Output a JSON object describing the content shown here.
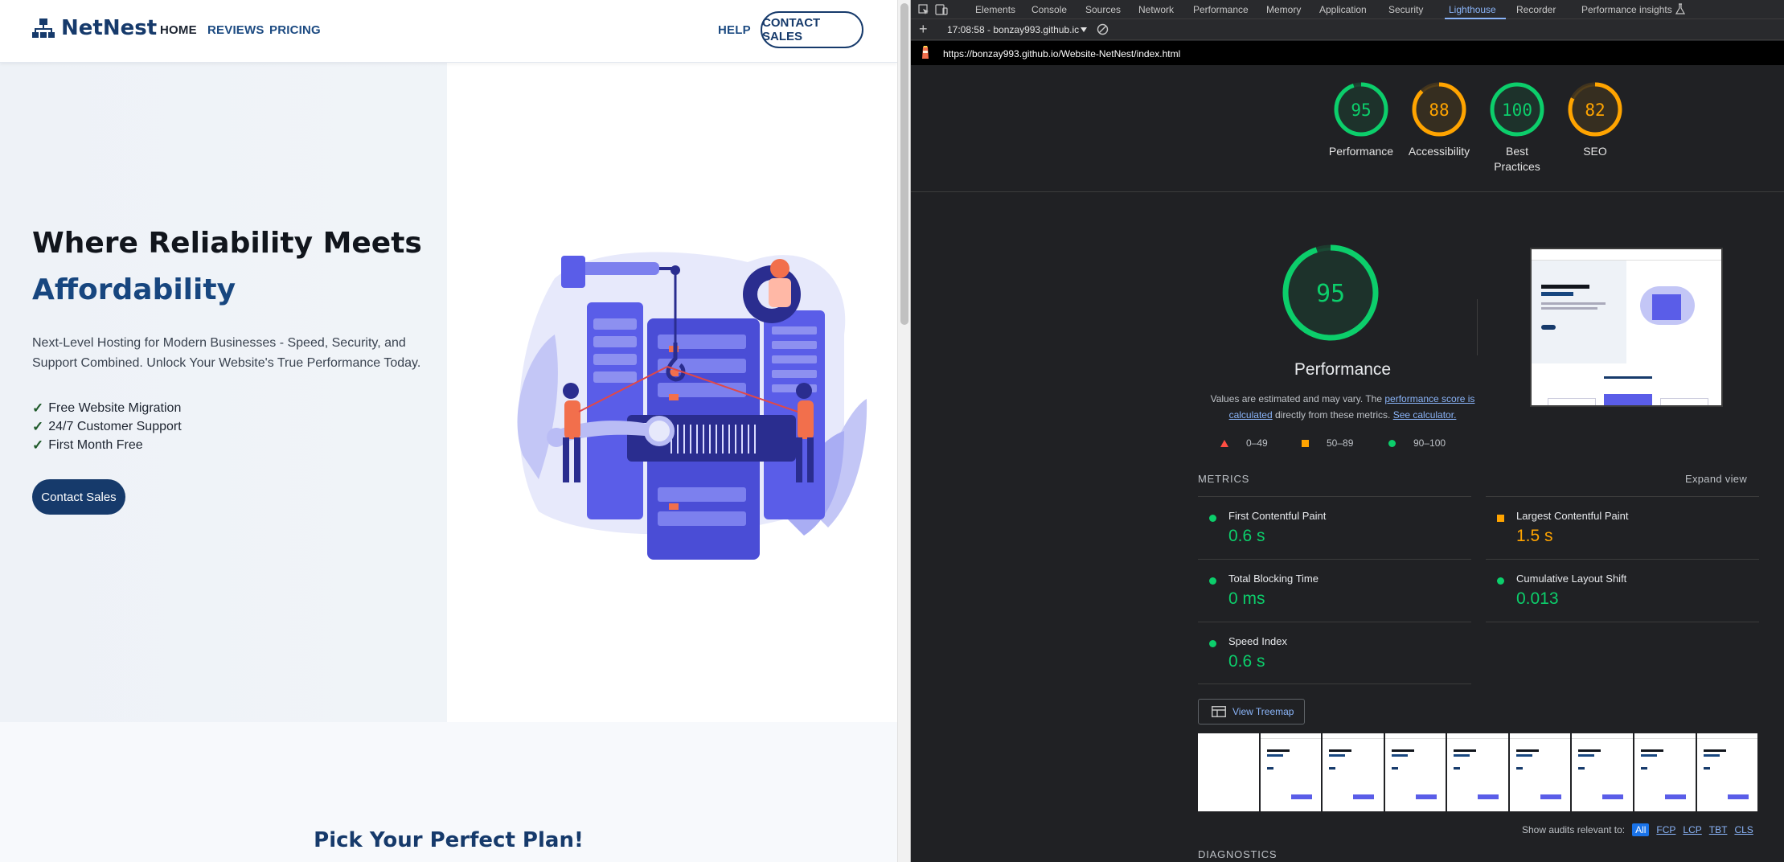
{
  "site": {
    "logo_text": "NetNest",
    "nav": {
      "home": "HOME",
      "reviews": "REVIEWS",
      "pricing": "PRICING",
      "help": "HELP",
      "contact_sales": "CONTACT SALES"
    },
    "hero": {
      "title_line1": "Where Reliability Meets",
      "title_line2": "Affordability",
      "subtitle": "Next-Level Hosting for Modern Businesses - Speed, Security, and Support Combined. Unlock Your Website's True Performance Today.",
      "features": [
        "Free Website Migration",
        "24/7 Customer Support",
        "First Month Free"
      ],
      "check_glyph": "✓",
      "cta": "Contact Sales"
    },
    "plans_title": "Pick Your Perfect Plan!",
    "colors": {
      "brand_navy": "#163a6b",
      "illustration_purple": "#5a5de8",
      "illustration_orange": "#f26f4c"
    }
  },
  "devtools": {
    "tabs": [
      "Elements",
      "Console",
      "Sources",
      "Network",
      "Performance",
      "Memory",
      "Application",
      "Security",
      "Lighthouse",
      "Recorder",
      "Performance insights"
    ],
    "active_tab": "Lighthouse",
    "toolbar_report": "17:08:58 - bonzay993.github.ic",
    "url": "https://bonzay993.github.io/Website-NetNest/index.html",
    "summary_scores": [
      {
        "score": 95,
        "label": "Performance",
        "color": "#0cce6b"
      },
      {
        "score": 88,
        "label": "Accessibility",
        "color": "#ffa400"
      },
      {
        "score": 100,
        "label": "Best Practices",
        "color": "#0cce6b"
      },
      {
        "score": 82,
        "label": "SEO",
        "color": "#ffa400"
      }
    ],
    "performance": {
      "score": 95,
      "title": "Performance",
      "note_prefix": "Values are estimated and may vary. The ",
      "note_link": "performance score is calculated",
      "note_mid": " directly from these metrics. ",
      "note_link2": "See calculator.",
      "legend": [
        "0–49",
        "50–89",
        "90–100"
      ]
    },
    "metrics_heading": "METRICS",
    "expand_view": "Expand view",
    "metrics": [
      {
        "name": "First Contentful Paint",
        "value": "0.6 s",
        "status": "pass"
      },
      {
        "name": "Largest Contentful Paint",
        "value": "1.5 s",
        "status": "average"
      },
      {
        "name": "Total Blocking Time",
        "value": "0 ms",
        "status": "pass"
      },
      {
        "name": "Cumulative Layout Shift",
        "value": "0.013",
        "status": "pass"
      },
      {
        "name": "Speed Index",
        "value": "0.6 s",
        "status": "pass"
      }
    ],
    "view_treemap": "View Treemap",
    "audits_label": "Show audits relevant to:",
    "audit_filters": [
      "All",
      "FCP",
      "LCP",
      "TBT",
      "CLS"
    ],
    "diagnostics_heading": "DIAGNOSTICS",
    "colors": {
      "pass": "#0cce6b",
      "average": "#ffa400",
      "fail": "#ff4e42",
      "link": "#8ab4f8"
    }
  }
}
